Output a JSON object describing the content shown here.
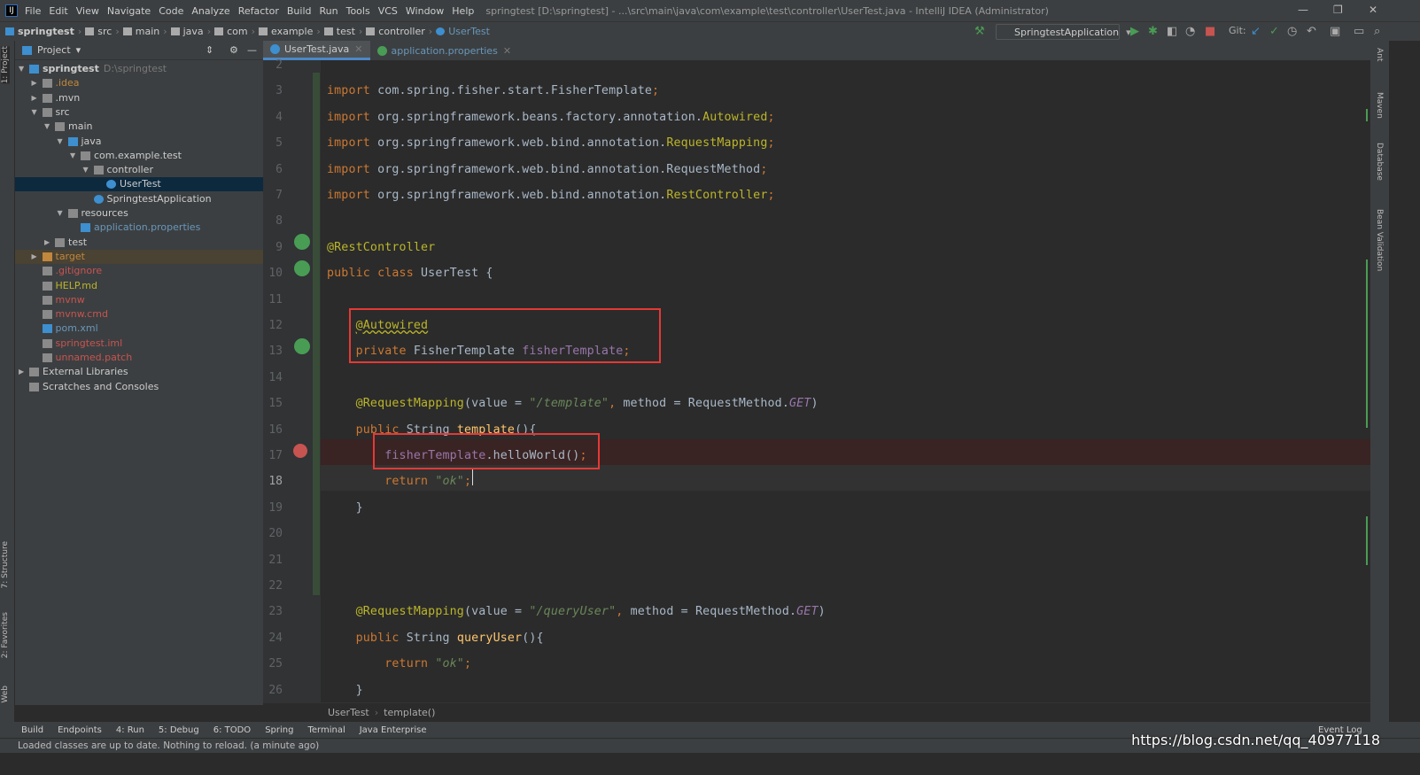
{
  "menubar": {
    "items": [
      "File",
      "Edit",
      "View",
      "Navigate",
      "Code",
      "Analyze",
      "Refactor",
      "Build",
      "Run",
      "Tools",
      "VCS",
      "Window",
      "Help"
    ],
    "title": "springtest [D:\\springtest] - ...\\src\\main\\java\\com\\example\\test\\controller\\UserTest.java - IntelliJ IDEA (Administrator)"
  },
  "breadcrumb": [
    "springtest",
    "src",
    "main",
    "java",
    "com",
    "example",
    "test",
    "controller",
    "UserTest"
  ],
  "run_config": "SpringtestApplication",
  "git_label": "Git:",
  "left_strip": [
    "1: Project",
    "7: Structure",
    "2: Favorites",
    "Web"
  ],
  "right_strip": [
    "Ant",
    "Maven",
    "Database",
    "Bean Validation"
  ],
  "project": {
    "title": "Project",
    "tree": [
      {
        "label": "springtest",
        "hint": "D:\\springtest",
        "depth": 0,
        "open": true,
        "icon": "module",
        "color": "#ccc",
        "bold": true
      },
      {
        "label": ".idea",
        "depth": 1,
        "open": false,
        "icon": "folder",
        "color": "#c0873d"
      },
      {
        "label": ".mvn",
        "depth": 1,
        "open": false,
        "icon": "folder",
        "color": "#ccc"
      },
      {
        "label": "src",
        "depth": 1,
        "open": true,
        "icon": "folder",
        "color": "#ccc"
      },
      {
        "label": "main",
        "depth": 2,
        "open": true,
        "icon": "folder",
        "color": "#ccc"
      },
      {
        "label": "java",
        "depth": 3,
        "open": true,
        "icon": "folder-blue",
        "color": "#ccc"
      },
      {
        "label": "com.example.test",
        "depth": 4,
        "open": true,
        "icon": "package",
        "color": "#ccc"
      },
      {
        "label": "controller",
        "depth": 5,
        "open": true,
        "icon": "package",
        "color": "#ccc"
      },
      {
        "label": "UserTest",
        "depth": 6,
        "icon": "class",
        "color": "#ccc",
        "selected": true
      },
      {
        "label": "SpringtestApplication",
        "depth": 5,
        "icon": "spring-class",
        "color": "#ccc"
      },
      {
        "label": "resources",
        "depth": 3,
        "open": true,
        "icon": "folder",
        "color": "#ccc"
      },
      {
        "label": "application.properties",
        "depth": 4,
        "icon": "properties",
        "color": "#6897bb"
      },
      {
        "label": "test",
        "depth": 2,
        "open": false,
        "icon": "folder",
        "color": "#ccc"
      },
      {
        "label": "target",
        "depth": 1,
        "open": false,
        "icon": "folder-orange",
        "color": "#c0873d",
        "highlight": true
      },
      {
        "label": ".gitignore",
        "depth": 1,
        "icon": "file",
        "color": "#c75450"
      },
      {
        "label": "HELP.md",
        "depth": 1,
        "icon": "file",
        "color": "#bbb529"
      },
      {
        "label": "mvnw",
        "depth": 1,
        "icon": "file",
        "color": "#c75450"
      },
      {
        "label": "mvnw.cmd",
        "depth": 1,
        "icon": "file",
        "color": "#c75450"
      },
      {
        "label": "pom.xml",
        "depth": 1,
        "icon": "maven",
        "color": "#6897bb"
      },
      {
        "label": "springtest.iml",
        "depth": 1,
        "icon": "file",
        "color": "#c75450"
      },
      {
        "label": "unnamed.patch",
        "depth": 1,
        "icon": "file",
        "color": "#c75450"
      },
      {
        "label": "External Libraries",
        "depth": 0,
        "open": false,
        "icon": "library",
        "color": "#ccc"
      },
      {
        "label": "Scratches and Consoles",
        "depth": 0,
        "icon": "scratches",
        "color": "#ccc"
      }
    ]
  },
  "tabs": [
    {
      "label": "UserTest.java",
      "active": true
    },
    {
      "label": "application.properties",
      "active": false
    }
  ],
  "code": [
    {
      "n": "2",
      "html": ""
    },
    {
      "n": "3",
      "html": "<span class='kw'>import </span>com.spring.fisher.start.FisherTemplate<span class='kw'>;</span>"
    },
    {
      "n": "4",
      "html": "<span class='kw'>import </span>org.springframework.beans.factory.annotation.<span class='an'>Autowired</span><span class='kw'>;</span>"
    },
    {
      "n": "5",
      "html": "<span class='kw'>import </span>org.springframework.web.bind.annotation.<span class='an'>RequestMapping</span><span class='kw'>;</span>"
    },
    {
      "n": "6",
      "html": "<span class='kw'>import </span>org.springframework.web.bind.annotation.RequestMethod<span class='kw'>;</span>"
    },
    {
      "n": "7",
      "html": "<span class='kw'>import </span>org.springframework.web.bind.annotation.<span class='an'>RestController</span><span class='kw'>;</span>"
    },
    {
      "n": "8",
      "html": ""
    },
    {
      "n": "9",
      "html": "<span class='an'>@RestController</span>"
    },
    {
      "n": "10",
      "html": "<span class='kw'>public class </span>UserTest {"
    },
    {
      "n": "11",
      "html": ""
    },
    {
      "n": "12",
      "html": "    <span class='an' style='text-decoration:underline wavy #bbb529'>@Autowired</span>"
    },
    {
      "n": "13",
      "html": "    <span class='kw'>private </span>FisherTemplate <span class='fd'>fisherTemplate</span><span class='kw'>;</span>"
    },
    {
      "n": "14",
      "html": ""
    },
    {
      "n": "15",
      "html": "    <span class='an'>@RequestMapping</span>(value = <span class='st'>\"/template\"</span><span class='kw'>, </span>method = RequestMethod.<span class='cn'>GET</span>)"
    },
    {
      "n": "16",
      "html": "    <span class='kw'>public </span>String <span class='mt'>template</span>(){"
    },
    {
      "n": "17",
      "html": "        <span class='fd'>fisherTemplate</span>.helloWorld()<span class='kw'>;</span>"
    },
    {
      "n": "18",
      "html": "        <span class='kw'>return </span><span class='st'>\"ok\"</span><span class='kw'>;</span>"
    },
    {
      "n": "19",
      "html": "    }"
    },
    {
      "n": "20",
      "html": ""
    },
    {
      "n": "21",
      "html": ""
    },
    {
      "n": "22",
      "html": ""
    },
    {
      "n": "23",
      "html": "    <span class='an'>@RequestMapping</span>(value = <span class='st'>\"/queryUser\"</span><span class='kw'>, </span>method = RequestMethod.<span class='cn'>GET</span>)"
    },
    {
      "n": "24",
      "html": "    <span class='kw'>public </span>String <span class='mt'>queryUser</span>(){"
    },
    {
      "n": "25",
      "html": "        <span class='kw'>return </span><span class='st'>\"ok\"</span><span class='kw'>;</span>"
    },
    {
      "n": "26",
      "html": "    }"
    }
  ],
  "editor_breadcrumb": [
    "UserTest",
    "template()"
  ],
  "toolwindows": [
    "Build",
    "Endpoints",
    "4: Run",
    "5: Debug",
    "6: TODO",
    "Spring",
    "Terminal",
    "Java Enterprise"
  ],
  "event_log": "Event Log",
  "status": "Loaded classes are up to date. Nothing to reload. (a minute ago)",
  "watermark": "https://blog.csdn.net/qq_40977118",
  "colors": {
    "accent": "#4a88c7",
    "highlight_box": "#e53935",
    "breakpoint": "#c75450"
  }
}
